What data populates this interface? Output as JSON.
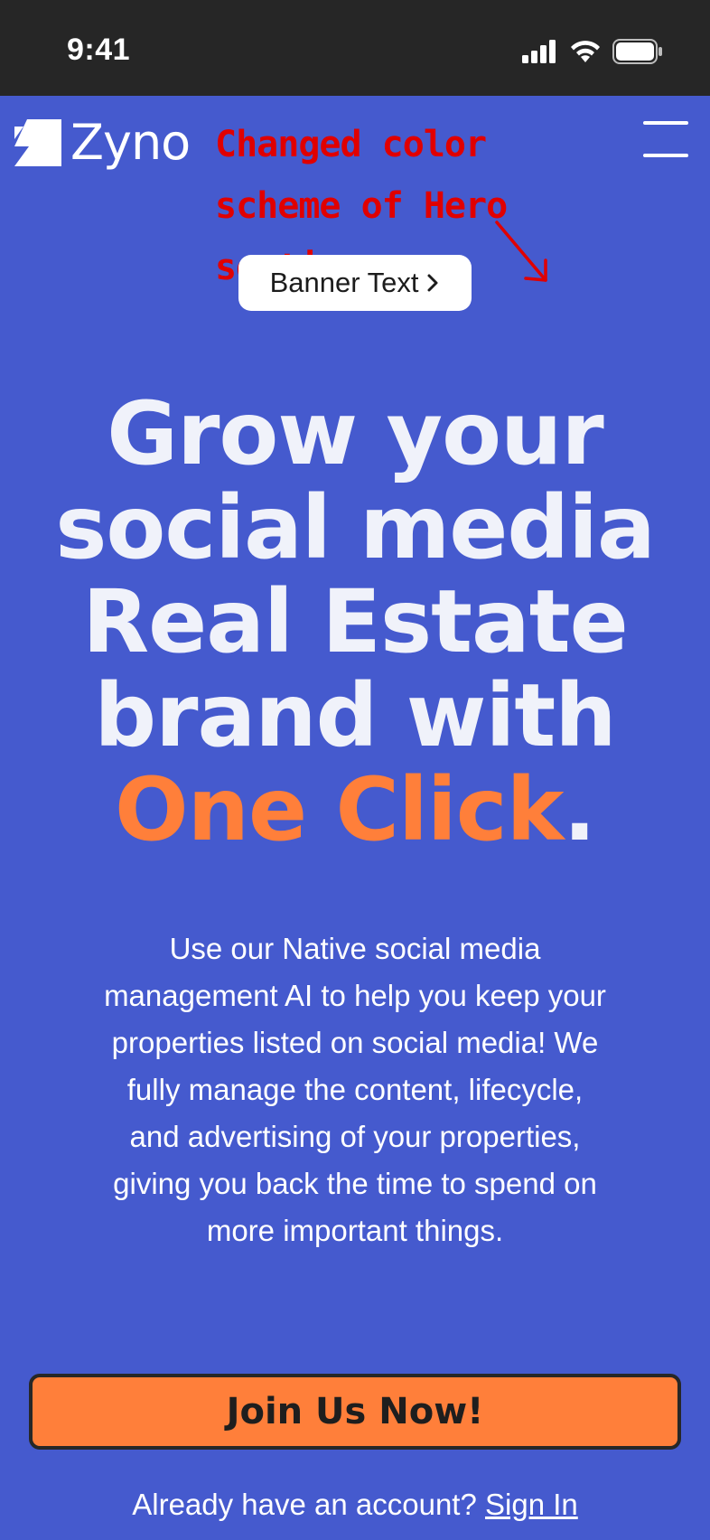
{
  "status_bar": {
    "time": "9:41",
    "icons": [
      "cellular-signal-icon",
      "wifi-icon",
      "battery-icon"
    ]
  },
  "header": {
    "logo_text": "Zyno",
    "logo_icon": "zyno-logo-icon",
    "menu_icon": "hamburger-menu-icon"
  },
  "annotation": {
    "text": "Changed color scheme of Hero section",
    "color": "#E00000"
  },
  "banner": {
    "label": "Banner Text",
    "icon": "chevron-right-icon"
  },
  "hero": {
    "headline_main": "Grow your social media Real Estate brand with",
    "headline_accent": "One Click",
    "headline_end": ".",
    "description": "Use our Native social media management AI to help you keep your properties listed on social media! We fully manage the content, lifecycle, and advertising of your properties, giving you back the time to spend  on more important things.",
    "cta_label": "Join Us Now!",
    "signin_prompt": "Already have an account?",
    "signin_link": "Sign In"
  },
  "colors": {
    "background": "#455ACE",
    "accent": "#FF7F3A",
    "status_bar": "#262626",
    "text": "#F0F2FA"
  }
}
